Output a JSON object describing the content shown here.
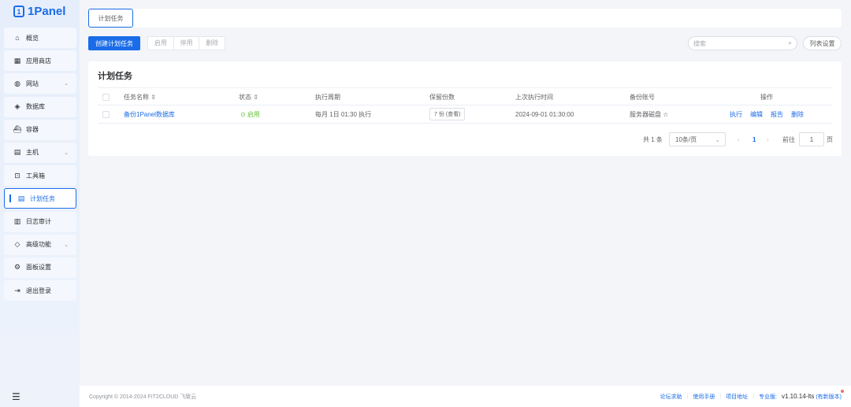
{
  "app": {
    "logo": "1Panel"
  },
  "sidebar": {
    "items": [
      {
        "label": "概览",
        "icon": "home-icon",
        "glyph": "⌂"
      },
      {
        "label": "应用商店",
        "icon": "grid-icon",
        "glyph": "▦"
      },
      {
        "label": "网站",
        "icon": "globe-icon",
        "glyph": "◍",
        "chevron": true
      },
      {
        "label": "数据库",
        "icon": "database-icon",
        "glyph": "◈"
      },
      {
        "label": "容器",
        "icon": "container-icon",
        "glyph": "⛴"
      },
      {
        "label": "主机",
        "icon": "server-icon",
        "glyph": "▤",
        "chevron": true
      },
      {
        "label": "工具箱",
        "icon": "toolbox-icon",
        "glyph": "⊡"
      },
      {
        "label": "计划任务",
        "icon": "calendar-icon",
        "glyph": "▤",
        "active": true
      },
      {
        "label": "日志审计",
        "icon": "log-icon",
        "glyph": "▥"
      },
      {
        "label": "高级功能",
        "icon": "diamond-icon",
        "glyph": "◇",
        "chevron": true
      },
      {
        "label": "面板设置",
        "icon": "gear-icon",
        "glyph": "⚙"
      },
      {
        "label": "退出登录",
        "icon": "logout-icon",
        "glyph": "⇥"
      }
    ]
  },
  "topbar": {
    "tab": "计划任务"
  },
  "toolbar": {
    "create": "创建计划任务",
    "enable": "启用",
    "disable": "停用",
    "delete": "删除",
    "search_placeholder": "搜索",
    "column_settings": "列表设置"
  },
  "card": {
    "title": "计划任务"
  },
  "table": {
    "headers": [
      "任务名称",
      "状态",
      "执行周期",
      "保留份数",
      "上次执行时间",
      "备份账号",
      "操作"
    ],
    "rows": [
      {
        "name": "备份1Panel数据库",
        "status": "启用",
        "cycle": "每月 1日 01:30 执行",
        "retain": "7 份 (查看)",
        "last": "2024-09-01 01:30:00",
        "account": "服务器磁盘 ☆",
        "actions": [
          "执行",
          "编辑",
          "报告",
          "删除"
        ]
      }
    ]
  },
  "pagination": {
    "total": "共 1 条",
    "page_size": "10条/页",
    "current": "1",
    "goto_label": "前往",
    "goto_value": "1",
    "page_suffix": "页"
  },
  "footer": {
    "copyright": "Copyright © 2014-2024 FIT2CLOUD 飞致云",
    "links": [
      "论坛求助",
      "使用手册",
      "项目地址"
    ],
    "edition": "专业版:",
    "version": "v1.10.14-lts",
    "new_version": "(有新版本)"
  }
}
